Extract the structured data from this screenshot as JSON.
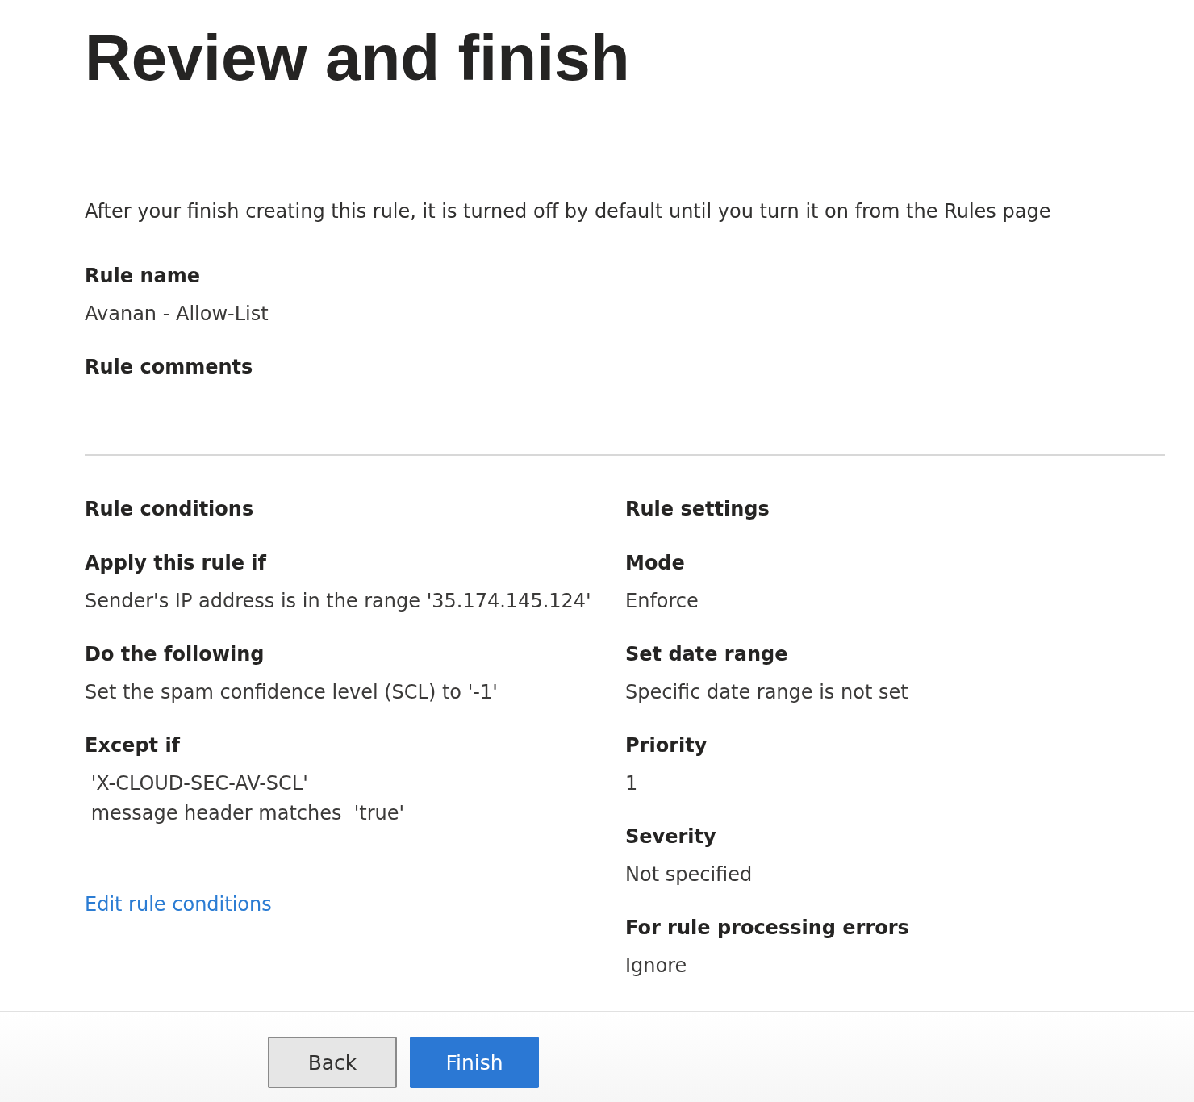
{
  "title": "Review and finish",
  "intro": "After your finish creating this rule, it is turned off by default until you turn it on from the Rules page",
  "summary": [
    {
      "label": "Rule name",
      "lines": [
        "Avanan - Allow-List"
      ]
    },
    {
      "label": "Rule comments"
    }
  ],
  "columns": [
    {
      "heading": "Rule conditions",
      "items": [
        {
          "label": "Apply this rule if",
          "lines": [
            "Sender's IP address is in the range '35.174.145.124'"
          ]
        },
        {
          "label": "Do the following",
          "lines": [
            "Set the spam confidence level (SCL) to '-1'"
          ]
        },
        {
          "label": "Except if",
          "lines": [
            " 'X-CLOUD-SEC-AV-SCL'",
            " message header matches  'true'"
          ]
        }
      ],
      "link": "Edit rule conditions"
    },
    {
      "heading": "Rule settings",
      "items": [
        {
          "label": "Mode",
          "lines": [
            "Enforce"
          ]
        },
        {
          "label": "Set date range",
          "lines": [
            "Specific date range is not set"
          ]
        },
        {
          "label": "Priority",
          "lines": [
            "1"
          ]
        },
        {
          "label": "Severity",
          "lines": [
            "Not specified"
          ]
        },
        {
          "label": "For rule processing errors",
          "lines": [
            "Ignore"
          ]
        }
      ]
    }
  ],
  "buttons": [
    {
      "label": "Back",
      "kind": "secondary"
    },
    {
      "label": "Finish",
      "kind": "primary"
    }
  ]
}
